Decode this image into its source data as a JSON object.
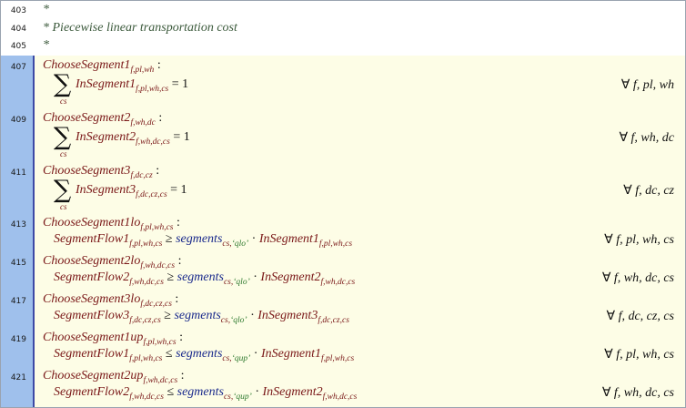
{
  "comments": [
    {
      "line": "403",
      "text": "*"
    },
    {
      "line": "404",
      "text": "* Piecewise linear transportation cost"
    },
    {
      "line": "405",
      "text": "*"
    }
  ],
  "forall_symbol": "∀",
  "sum_symbol": "∑",
  "constraints": [
    {
      "line": "407",
      "name": "ChooseSegment1",
      "name_sub": "f,pl,wh",
      "colon": ":",
      "kind": "sum",
      "sum_index": "cs",
      "var": "InSegment1",
      "var_sub": "f,pl,wh,cs",
      "rhs": "= 1",
      "domain": "f, pl, wh"
    },
    {
      "line": "409",
      "name": "ChooseSegment2",
      "name_sub": "f,wh,dc",
      "colon": ":",
      "kind": "sum",
      "sum_index": "cs",
      "var": "InSegment2",
      "var_sub": "f,wh,dc,cs",
      "rhs": "= 1",
      "domain": "f, wh, dc"
    },
    {
      "line": "411",
      "name": "ChooseSegment3",
      "name_sub": "f,dc,cz",
      "colon": ":",
      "kind": "sum",
      "sum_index": "cs",
      "var": "InSegment3",
      "var_sub": "f,dc,cz,cs",
      "rhs": "= 1",
      "domain": "f, dc, cz"
    },
    {
      "line": "413",
      "name": "ChooseSegment1lo",
      "name_sub": "f,pl,wh,cs",
      "colon": ":",
      "kind": "bound",
      "lhs": "SegmentFlow1",
      "lhs_sub": "f,pl,wh,cs",
      "op": "≥",
      "param": "segments",
      "param_sub_a": "cs,",
      "param_sub_b": "‘qlo’",
      "dot": "·",
      "var": "InSegment1",
      "var_sub": "f,pl,wh,cs",
      "domain": "f, pl, wh, cs"
    },
    {
      "line": "415",
      "name": "ChooseSegment2lo",
      "name_sub": "f,wh,dc,cs",
      "colon": ":",
      "kind": "bound",
      "lhs": "SegmentFlow2",
      "lhs_sub": "f,wh,dc,cs",
      "op": "≥",
      "param": "segments",
      "param_sub_a": "cs,",
      "param_sub_b": "‘qlo’",
      "dot": "·",
      "var": "InSegment2",
      "var_sub": "f,wh,dc,cs",
      "domain": "f, wh, dc, cs"
    },
    {
      "line": "417",
      "name": "ChooseSegment3lo",
      "name_sub": "f,dc,cz,cs",
      "colon": ":",
      "kind": "bound",
      "lhs": "SegmentFlow3",
      "lhs_sub": "f,dc,cz,cs",
      "op": "≥",
      "param": "segments",
      "param_sub_a": "cs,",
      "param_sub_b": "‘qlo’",
      "dot": "·",
      "var": "InSegment3",
      "var_sub": "f,dc,cz,cs",
      "domain": "f, dc, cz, cs"
    },
    {
      "line": "419",
      "name": "ChooseSegment1up",
      "name_sub": "f,pl,wh,cs",
      "colon": ":",
      "kind": "bound",
      "lhs": "SegmentFlow1",
      "lhs_sub": "f,pl,wh,cs",
      "op": "≤",
      "param": "segments",
      "param_sub_a": "cs,",
      "param_sub_b": "‘qup’",
      "dot": "·",
      "var": "InSegment1",
      "var_sub": "f,pl,wh,cs",
      "domain": "f, pl, wh, cs"
    },
    {
      "line": "421",
      "name": "ChooseSegment2up",
      "name_sub": "f,wh,dc,cs",
      "colon": ":",
      "kind": "bound",
      "lhs": "SegmentFlow2",
      "lhs_sub": "f,wh,dc,cs",
      "op": "≤",
      "param": "segments",
      "param_sub_a": "cs,",
      "param_sub_b": "‘qup’",
      "dot": "·",
      "var": "InSegment2",
      "var_sub": "f,wh,dc,cs",
      "domain": "f, wh, dc, cs"
    }
  ]
}
